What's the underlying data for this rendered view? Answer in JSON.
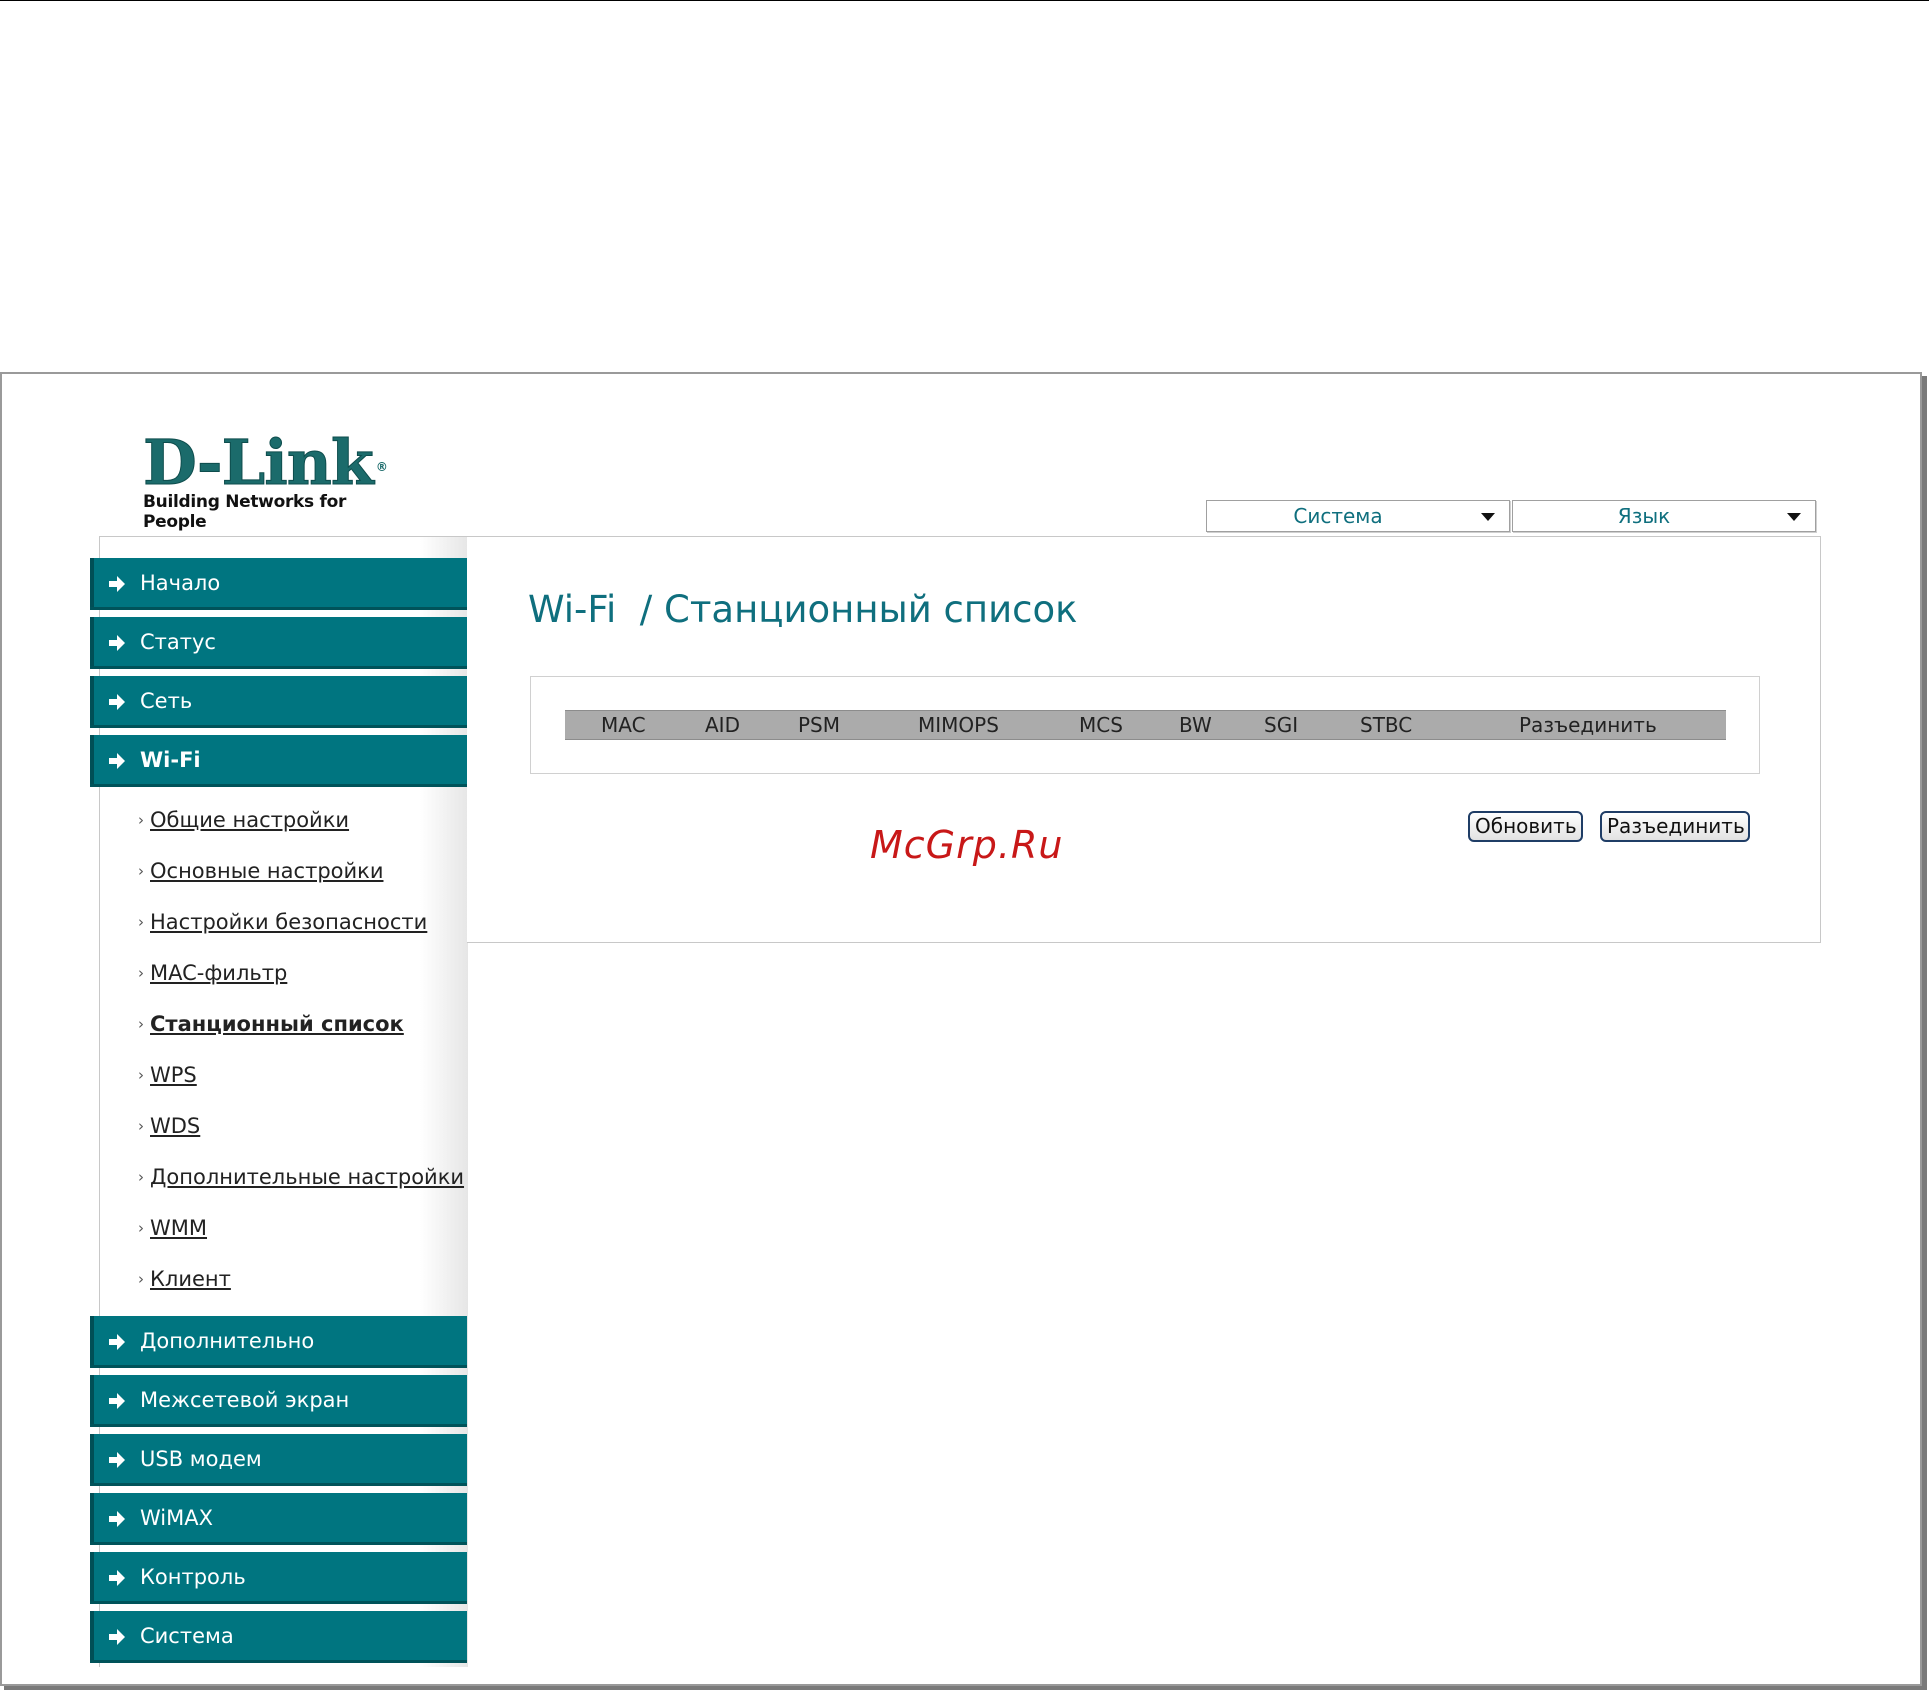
{
  "logo": {
    "brand": "D-Link",
    "registered": "®",
    "tagline": "Building Networks for People"
  },
  "header": {
    "system_dropdown": "Система",
    "language_dropdown": "Язык"
  },
  "sidebar": {
    "top_items": [
      {
        "label": "Начало"
      },
      {
        "label": "Статус"
      },
      {
        "label": "Сеть"
      },
      {
        "label": "Wi-Fi",
        "active": true
      }
    ],
    "wifi_subitems": [
      {
        "label": "Общие настройки"
      },
      {
        "label": "Основные настройки"
      },
      {
        "label": "Настройки безопасности"
      },
      {
        "label": "MAC-фильтр"
      },
      {
        "label": "Станционный список",
        "current": true
      },
      {
        "label": "WPS"
      },
      {
        "label": "WDS"
      },
      {
        "label": "Дополнительные настройки"
      },
      {
        "label": "WMM"
      },
      {
        "label": "Клиент"
      }
    ],
    "bottom_items": [
      {
        "label": "Дополнительно"
      },
      {
        "label": "Межсетевой экран"
      },
      {
        "label": "USB модем"
      },
      {
        "label": "WiMAX"
      },
      {
        "label": "Контроль"
      },
      {
        "label": "Система"
      }
    ]
  },
  "main": {
    "title": "Wi-Fi  / Станционный список",
    "table": {
      "columns": [
        "MAC",
        "AID",
        "PSM",
        "MIMOPS",
        "MCS",
        "BW",
        "SGI",
        "STBC",
        "Разъединить"
      ],
      "rows": []
    },
    "buttons": {
      "refresh": "Обновить",
      "disconnect": "Разъединить"
    }
  },
  "watermark": "McGrp.Ru",
  "colors": {
    "accent": "#007580",
    "title": "#0f6f7e",
    "header_row": "#ababab",
    "watermark": "#c81818"
  }
}
